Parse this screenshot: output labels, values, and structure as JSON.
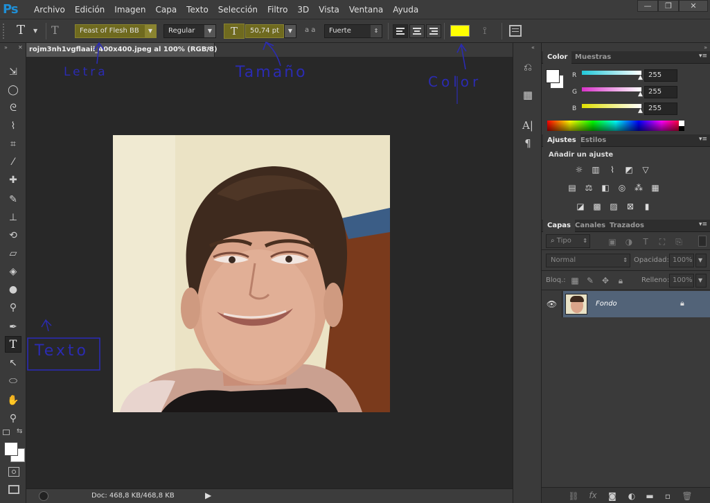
{
  "app": {
    "logo": "Ps"
  },
  "menu": [
    "Archivo",
    "Edición",
    "Imagen",
    "Capa",
    "Texto",
    "Selección",
    "Filtro",
    "3D",
    "Vista",
    "Ventana",
    "Ayuda"
  ],
  "window_controls": {
    "minimize": "—",
    "restore": "❐",
    "close": "✕"
  },
  "options_bar": {
    "tool_glyph": "T",
    "font_family": "Feast of Flesh BB",
    "font_style": "Regular",
    "font_size": "50,74 pt",
    "aa_label": "a a",
    "antialias": "Fuerte",
    "text_color": "#ffff00"
  },
  "document": {
    "tab_title": "rojm3nh1vgflaaii_400x400.jpeg al 100% (RGB/8)",
    "tab_close": "✕",
    "status": "Doc: 468,8 KB/468,8 KB"
  },
  "annotations": {
    "letra": "Letra",
    "tamano": "Tamaño",
    "color": "Color",
    "texto": "Texto"
  },
  "color_panel": {
    "tabs": [
      "Color",
      "Muestras"
    ],
    "channels": [
      {
        "label": "R",
        "value": "255",
        "color": "#22c8d8"
      },
      {
        "label": "G",
        "value": "255",
        "color": "#d832c8"
      },
      {
        "label": "B",
        "value": "255",
        "color": "#e0e000"
      }
    ]
  },
  "adjustments_panel": {
    "tabs": [
      "Ajustes",
      "Estilos"
    ],
    "heading": "Añadir un ajuste"
  },
  "layers_panel": {
    "tabs": [
      "Capas",
      "Canales",
      "Trazados"
    ],
    "filter_label": "Tipo",
    "blend_mode": "Normal",
    "opacity_label": "Opacidad:",
    "opacity_value": "100%",
    "lock_label": "Bloq.:",
    "fill_label": "Relleno:",
    "fill_value": "100%",
    "layers": [
      {
        "name": "Fondo"
      }
    ]
  }
}
